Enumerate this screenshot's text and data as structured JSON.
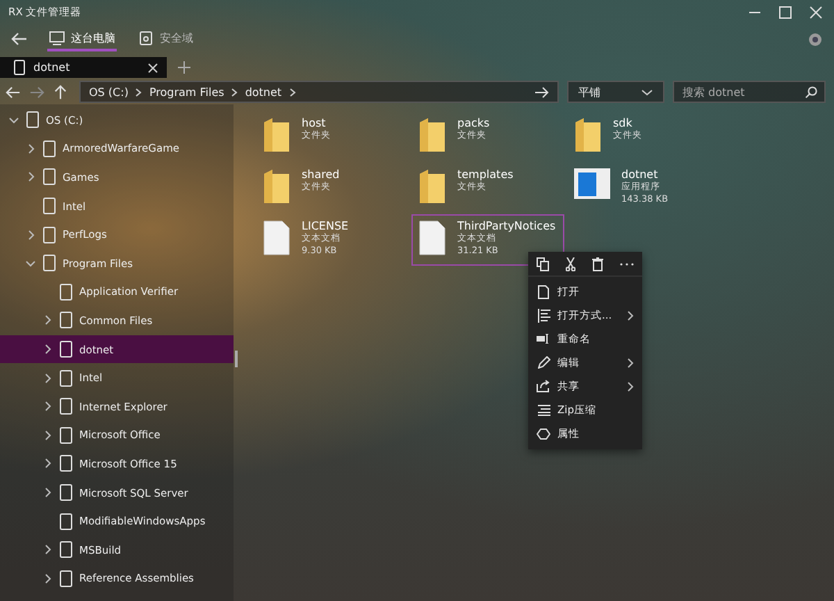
{
  "window": {
    "title": "RX 文件管理器"
  },
  "nav_tabs": [
    {
      "label": "这台电脑",
      "selected": true
    },
    {
      "label": "安全域",
      "selected": false
    }
  ],
  "tabs": [
    {
      "label": "dotnet",
      "selected": true
    }
  ],
  "address_bar": {
    "path": [
      "OS (C:)",
      "Program Files",
      "dotnet"
    ]
  },
  "view_dropdown": {
    "value": "平铺"
  },
  "search": {
    "placeholder": "搜索 dotnet"
  },
  "tree": [
    {
      "label": "OS (C:)",
      "expanded": true,
      "selected": false,
      "children": [
        {
          "label": "ArmoredWarfareGame",
          "expanded": false,
          "selected": false
        },
        {
          "label": "Games",
          "expanded": false,
          "selected": false
        },
        {
          "label": "Intel",
          "selected": false
        },
        {
          "label": "PerfLogs",
          "expanded": false,
          "selected": false
        },
        {
          "label": "Program Files",
          "expanded": true,
          "selected": false,
          "children": [
            {
              "label": "Application Verifier",
              "selected": false
            },
            {
              "label": "Common Files",
              "expanded": false,
              "selected": false
            },
            {
              "label": "dotnet",
              "expanded": false,
              "selected": true
            },
            {
              "label": "Intel",
              "expanded": false,
              "selected": false
            },
            {
              "label": "Internet Explorer",
              "expanded": false,
              "selected": false
            },
            {
              "label": "Microsoft Office",
              "expanded": false,
              "selected": false
            },
            {
              "label": "Microsoft Office 15",
              "expanded": false,
              "selected": false
            },
            {
              "label": "Microsoft SQL Server",
              "expanded": false,
              "selected": false
            },
            {
              "label": "ModifiableWindowsApps",
              "selected": false
            },
            {
              "label": "MSBuild",
              "expanded": false,
              "selected": false
            },
            {
              "label": "Reference Assemblies",
              "expanded": false,
              "selected": false
            }
          ]
        }
      ]
    }
  ],
  "files": [
    {
      "kind": "folder",
      "name": "host",
      "type": "文件夹",
      "selected": false
    },
    {
      "kind": "folder",
      "name": "packs",
      "type": "文件夹",
      "selected": false
    },
    {
      "kind": "folder",
      "name": "sdk",
      "type": "文件夹",
      "selected": false
    },
    {
      "kind": "folder",
      "name": "shared",
      "type": "文件夹",
      "selected": false
    },
    {
      "kind": "folder",
      "name": "templates",
      "type": "文件夹",
      "selected": false
    },
    {
      "kind": "app",
      "name": "dotnet",
      "type": "应用程序",
      "size": "143.38 KB",
      "selected": false
    },
    {
      "kind": "document",
      "name": "LICENSE",
      "type": "文本文档",
      "size": "9.30 KB",
      "selected": false
    },
    {
      "kind": "document",
      "name": "ThirdPartyNotices",
      "type": "文本文档",
      "size": "31.21 KB",
      "selected": true
    }
  ],
  "context_menu": {
    "toolbar": [
      {
        "kind": "copy"
      },
      {
        "kind": "cut"
      },
      {
        "kind": "delete"
      },
      {
        "kind": "more"
      }
    ],
    "items": [
      {
        "kind": "open",
        "label": "打开",
        "submenu": false
      },
      {
        "kind": "open-with",
        "label": "打开方式...",
        "submenu": true
      },
      {
        "kind": "rename",
        "label": "重命名",
        "submenu": false
      },
      {
        "kind": "edit",
        "label": "编辑",
        "submenu": true
      },
      {
        "kind": "share",
        "label": "共享",
        "submenu": true
      },
      {
        "kind": "zip",
        "label": "Zip压缩",
        "submenu": false
      },
      {
        "kind": "properties",
        "label": "属性",
        "submenu": false
      }
    ]
  }
}
